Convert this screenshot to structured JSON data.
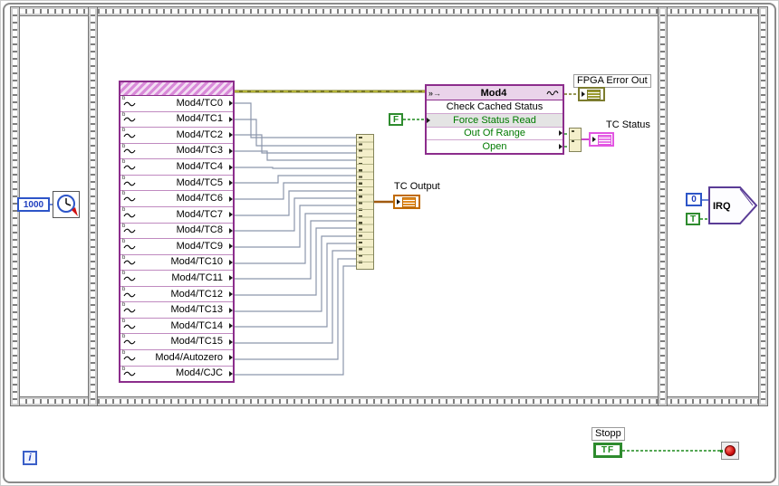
{
  "diagram": {
    "left_frame": {
      "loop_timer_value": "1000"
    },
    "io_node": {
      "channels": [
        "Mod4/TC0",
        "Mod4/TC1",
        "Mod4/TC2",
        "Mod4/TC3",
        "Mod4/TC4",
        "Mod4/TC5",
        "Mod4/TC6",
        "Mod4/TC7",
        "Mod4/TC8",
        "Mod4/TC9",
        "Mod4/TC10",
        "Mod4/TC11",
        "Mod4/TC12",
        "Mod4/TC13",
        "Mod4/TC14",
        "Mod4/TC15",
        "Mod4/Autozero",
        "Mod4/CJC"
      ]
    },
    "tc_output_label": "TC Output",
    "method_node": {
      "class_name": "Mod4",
      "method_name": "Check Cached Status",
      "input": "Force Status Read",
      "outputs": [
        "Out Of Range",
        "Open"
      ],
      "ref_icon": "»→",
      "wave_icon": "~"
    },
    "fpga_error_out_label": "FPGA Error Out",
    "tc_status_label": "TC Status",
    "false_constant": "F",
    "irq": {
      "count": "0",
      "enable": "T",
      "label": "IRQ"
    },
    "loop": {
      "iteration_label": "i",
      "stop_label": "Stopp",
      "stop_terminal": "TF"
    },
    "colors": {
      "io_node_border": "#8c2d8c",
      "boolean_green": "#1d8a1d",
      "integer_blue": "#2d55c8",
      "error_olive": "#77771e",
      "status_pink": "#e255e2",
      "output_orange": "#c06a00"
    }
  }
}
